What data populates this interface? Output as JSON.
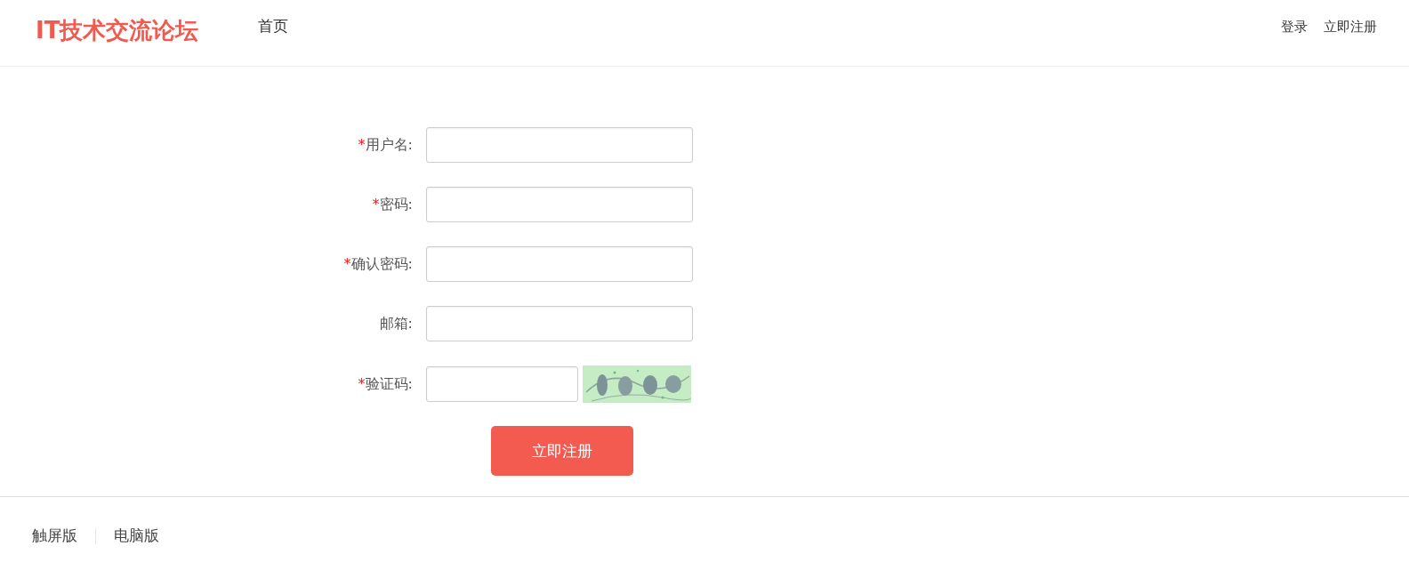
{
  "header": {
    "logo": "IT技术交流论坛",
    "nav": [
      {
        "label": "首页"
      }
    ],
    "user_links": [
      {
        "label": "登录"
      },
      {
        "label": "立即注册"
      }
    ]
  },
  "form": {
    "fields": [
      {
        "kind": "text",
        "label": "用户名:",
        "required_mark": "*"
      },
      {
        "kind": "text",
        "label": "密码:",
        "required_mark": "*"
      },
      {
        "kind": "text",
        "label": "确认密码:",
        "required_mark": "*"
      },
      {
        "kind": "text",
        "label": "邮箱:"
      },
      {
        "kind": "captcha",
        "label": "验证码:",
        "required_mark": "*"
      }
    ],
    "submit": "立即注册"
  },
  "footer": {
    "links": [
      {
        "label": "触屏版"
      },
      {
        "label": "电脑版"
      }
    ]
  }
}
